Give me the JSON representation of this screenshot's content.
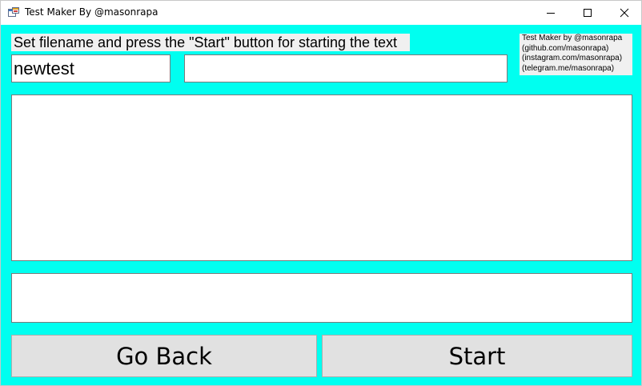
{
  "window": {
    "title": "Test Maker By @masonrapa",
    "icon": "app-window-icon"
  },
  "titlebar_buttons": {
    "minimize": "minimize-icon",
    "maximize": "maximize-icon",
    "close": "close-icon"
  },
  "form": {
    "instruction": "Set filename and press the \"Start\" button for starting the text",
    "filename_value": "newtest",
    "second_field_value": "",
    "main_text_value": "",
    "bottom_field_value": ""
  },
  "credits": {
    "lines": [
      "Test Maker by @masonrapa",
      "(github.com/masonrapa)",
      "(instagram.com/masonrapa)",
      "(telegram.me/masonrapa)"
    ]
  },
  "buttons": {
    "back_label": "Go Back",
    "start_label": "Start"
  },
  "colors": {
    "background": "#00fff0",
    "label_background": "#f0f0f0",
    "button_background": "#e1e1e1"
  }
}
